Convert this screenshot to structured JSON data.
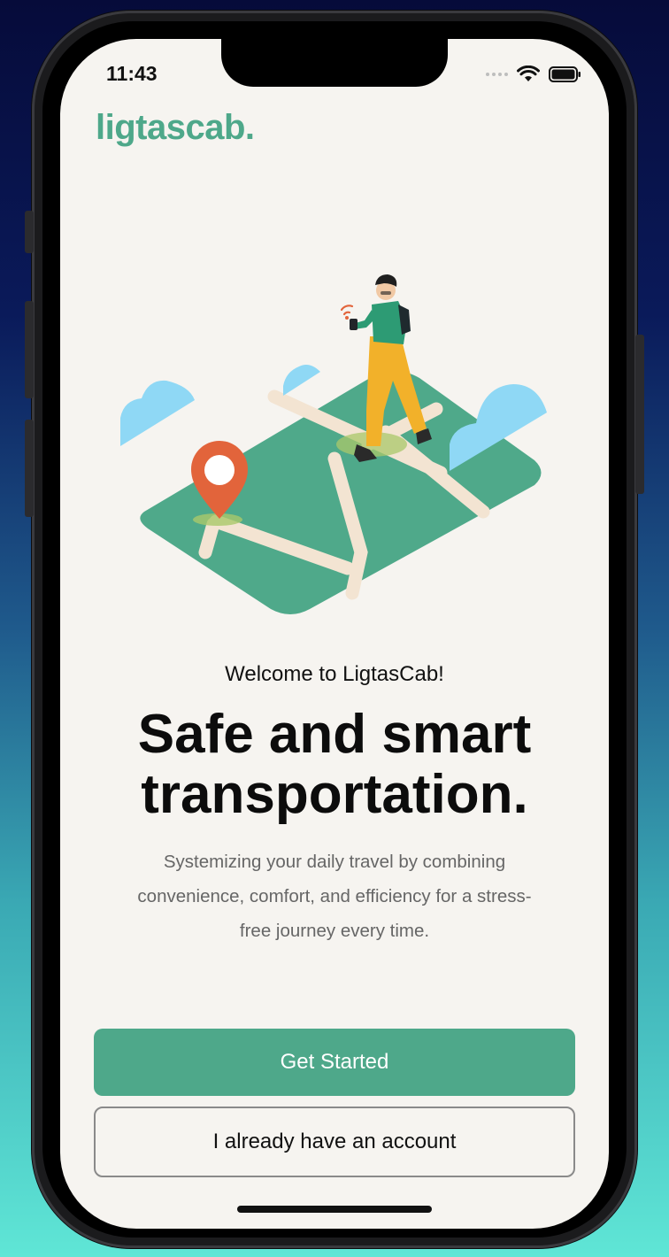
{
  "status_bar": {
    "time": "11:43"
  },
  "brand": {
    "logo_text": "ligtascab."
  },
  "hero": {
    "illustration": "person-walking-on-map-with-location-pin",
    "icons": [
      "location-pin-icon",
      "cloud-icon",
      "signal-icon"
    ]
  },
  "onboarding": {
    "welcome": "Welcome to LigtasCab!",
    "headline_line1": "Safe and smart",
    "headline_line2": "transportation.",
    "subtext_line1": "Systemizing your daily travel by combining",
    "subtext_line2": "convenience, comfort, and efficiency for a stress-",
    "subtext_line3": "free journey every time."
  },
  "actions": {
    "primary_label": "Get Started",
    "secondary_label": "I already have an account"
  },
  "colors": {
    "brand_green": "#4ea88a",
    "background": "#f6f4f0",
    "map_green": "#4fa98a",
    "road": "#f3e4d2",
    "pin_orange": "#e2643b",
    "cloud_blue": "#8fd8f5",
    "pants_yellow": "#f2b12a"
  }
}
